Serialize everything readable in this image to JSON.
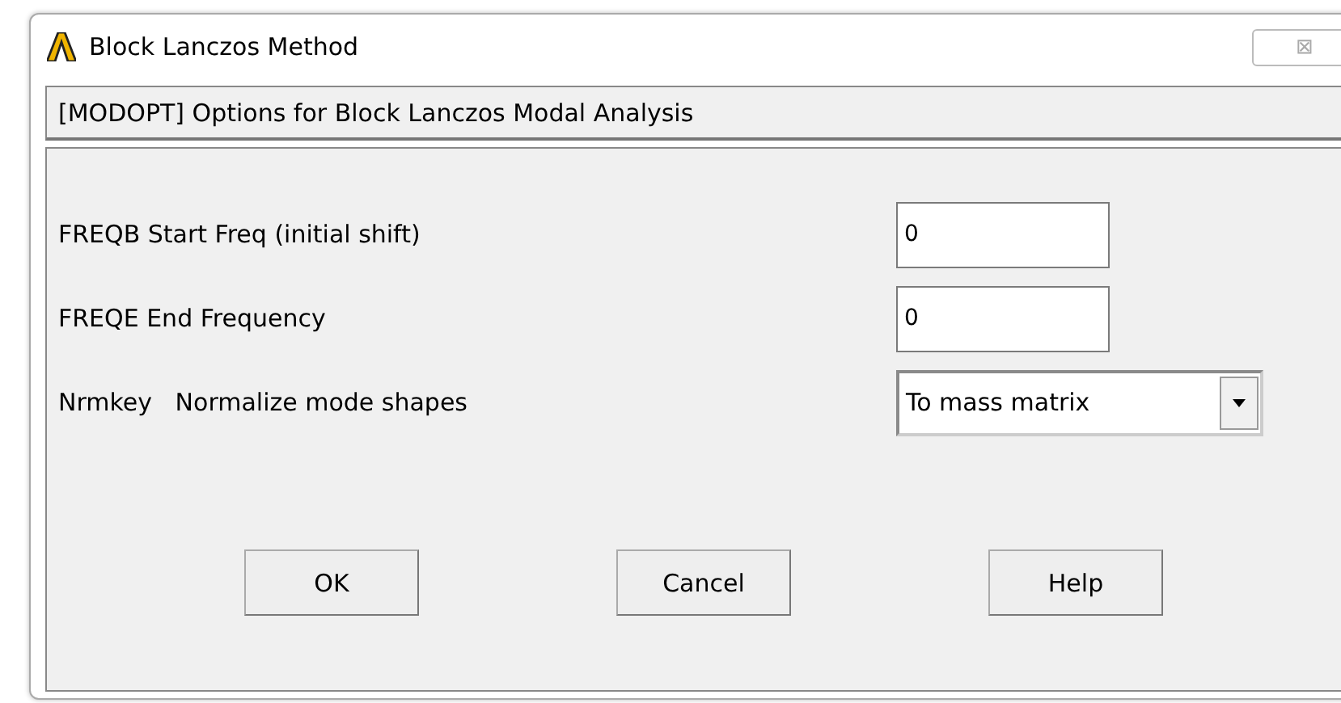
{
  "window": {
    "title": "Block Lanczos Method",
    "close": "⊠"
  },
  "header": "[MODOPT]  Options for Block Lanczos Modal Analysis",
  "fields": [
    {
      "kind": "text",
      "label": "FREQB Start Freq (initial shift)",
      "value": "0"
    },
    {
      "kind": "text",
      "label": "FREQE End Frequency",
      "value": "0"
    },
    {
      "kind": "dropdown",
      "label": "Nrmkey   Normalize mode shapes",
      "value": "To mass matrix"
    }
  ],
  "buttons": [
    "OK",
    "Cancel",
    "Help"
  ]
}
